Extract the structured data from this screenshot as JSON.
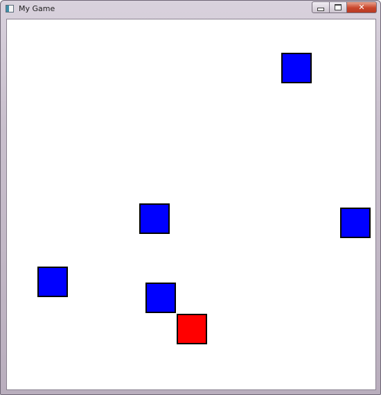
{
  "window": {
    "title": "My Game",
    "icon": "app-window-icon",
    "buttons": [
      {
        "name": "minimize-button",
        "icon": "minimize-icon"
      },
      {
        "name": "maximize-button",
        "icon": "maximize-icon"
      },
      {
        "name": "close-button",
        "icon": "close-icon",
        "glyph": "✕"
      }
    ]
  },
  "game": {
    "background_color": "#ffffff",
    "border_color": "#000000",
    "player_color": "#ff0000",
    "enemy_color": "#0000ff"
  }
}
